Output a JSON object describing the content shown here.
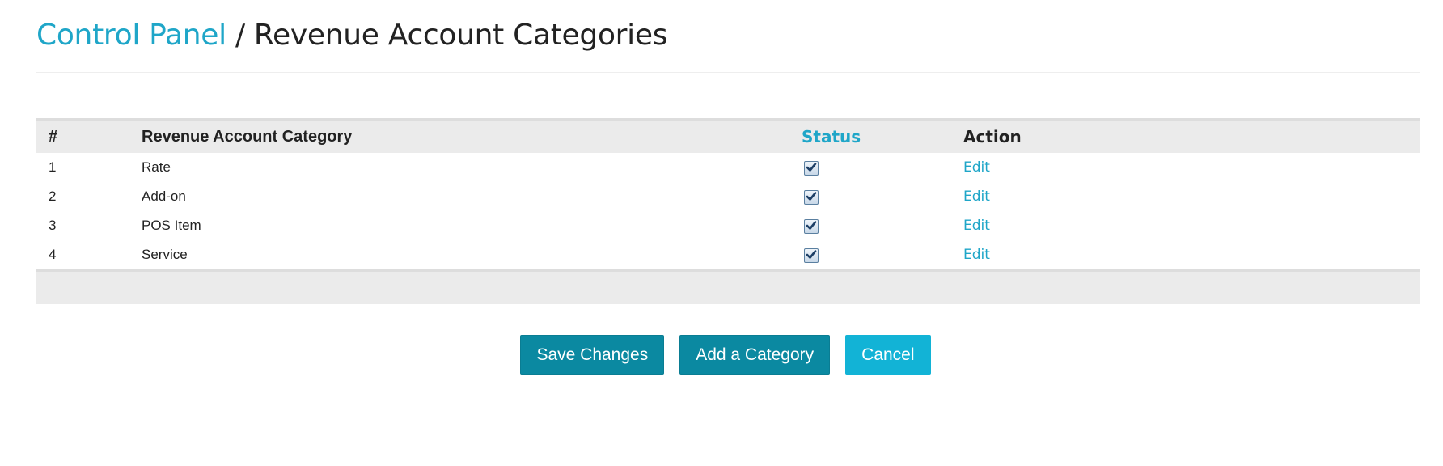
{
  "header": {
    "breadcrumb_link": "Control Panel",
    "separator": " / ",
    "current": "Revenue Account Categories"
  },
  "table": {
    "columns": {
      "number": "#",
      "category": "Revenue Account Category",
      "status": "Status",
      "action": "Action"
    },
    "rows": [
      {
        "number": "1",
        "category": "Rate",
        "status": true,
        "action": "Edit"
      },
      {
        "number": "2",
        "category": "Add-on",
        "status": true,
        "action": "Edit"
      },
      {
        "number": "3",
        "category": "POS Item",
        "status": true,
        "action": "Edit"
      },
      {
        "number": "4",
        "category": "Service",
        "status": true,
        "action": "Edit"
      }
    ]
  },
  "buttons": {
    "save": "Save Changes",
    "add": "Add a Category",
    "cancel": "Cancel"
  },
  "colors": {
    "link": "#1fa6c8",
    "primary_button": "#0b89a1",
    "cancel_button": "#12b3d6",
    "table_header_bg": "#ebebeb"
  },
  "icons": {
    "status_checkbox": "checkbox-checked-icon"
  }
}
